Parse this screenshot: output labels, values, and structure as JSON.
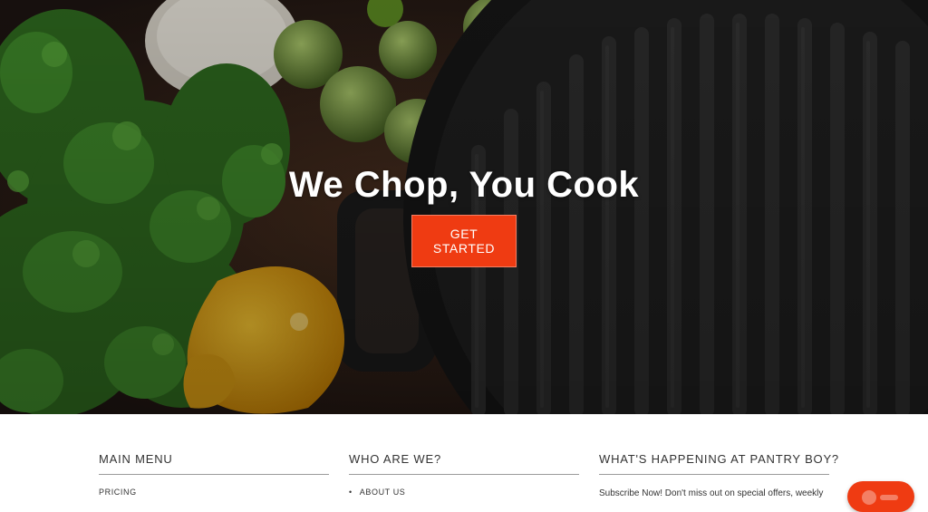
{
  "hero": {
    "title": "We Chop, You Cook",
    "cta_label": "GET STARTED",
    "accent_color": "#ef3b12",
    "background_image": "cutting-board-with-parsley-brussels-sprouts-yellow-pepper-and-cast-iron-grill-pan"
  },
  "footer": {
    "columns": [
      {
        "heading": "MAIN MENU",
        "links": [
          "PRICING"
        ]
      },
      {
        "heading": "WHO ARE WE?",
        "links": [
          "ABOUT US"
        ]
      },
      {
        "heading": "WHAT'S HAPPENING AT PANTRY BOY?",
        "text": "Subscribe Now! Don't miss out on special offers, weekly"
      }
    ]
  },
  "chat_widget": {
    "icon": "chat-icon"
  }
}
